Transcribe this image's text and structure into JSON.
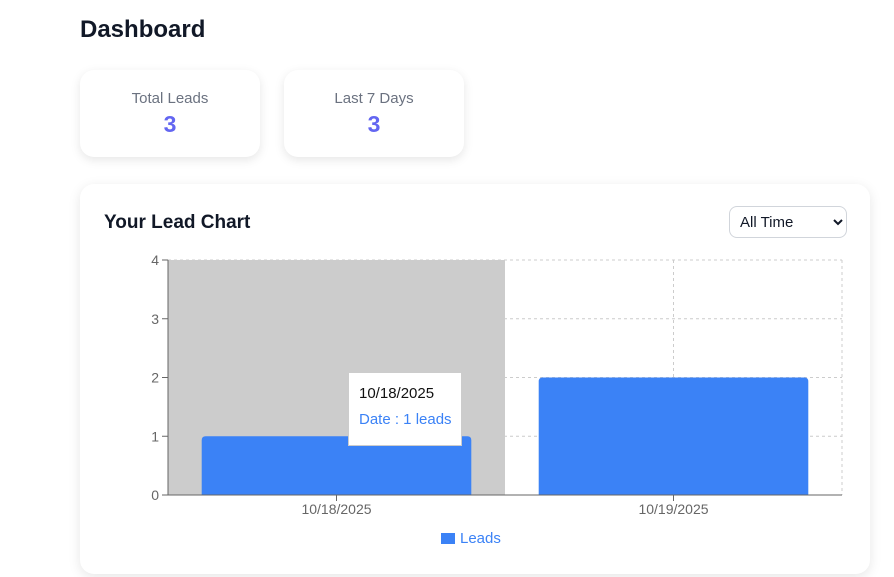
{
  "page": {
    "title": "Dashboard"
  },
  "stats": [
    {
      "label": "Total Leads",
      "value": "3"
    },
    {
      "label": "Last 7 Days",
      "value": "3"
    }
  ],
  "chart_card": {
    "title": "Your Lead Chart",
    "range_select": {
      "selected": "All Time"
    }
  },
  "tooltip": {
    "date": "10/18/2025",
    "value_text": "Date : 1 leads"
  },
  "colors": {
    "accent": "#6366f1",
    "bar": "#3b82f6",
    "hover_band": "#cccccc"
  },
  "chart_data": {
    "type": "bar",
    "categories": [
      "10/18/2025",
      "10/19/2025"
    ],
    "series": [
      {
        "name": "Leads",
        "values": [
          1,
          2
        ]
      }
    ],
    "ylim": [
      0,
      4
    ],
    "yticks": [
      0,
      1,
      2,
      3,
      4
    ],
    "grid": true,
    "legend_position": "bottom",
    "active_category": "10/18/2025"
  }
}
